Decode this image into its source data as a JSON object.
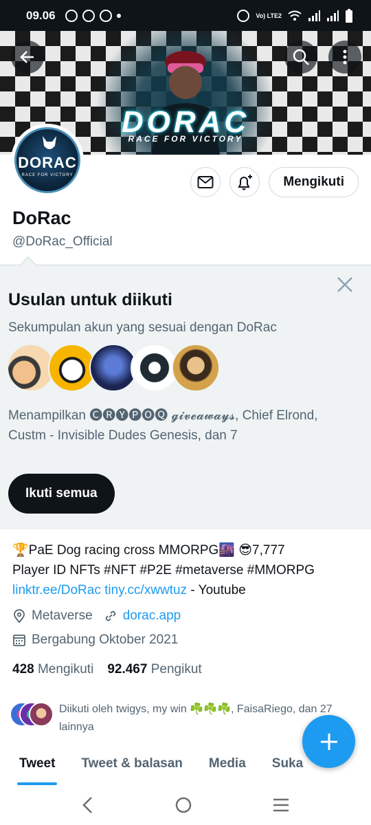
{
  "status_bar": {
    "time": "09.06",
    "icons_left": [
      "whatsapp-icon",
      "messenger-icon",
      "facebook-icon",
      "dot-icon"
    ],
    "icons_right": [
      "alarm-icon",
      "volte-icon",
      "wifi-icon",
      "signal-icon",
      "signal-icon",
      "battery-icon"
    ],
    "volte_text": "Vo) LTE2"
  },
  "banner": {
    "title": "DORAC",
    "subtitle": "RACE FOR VICTORY",
    "accent_color": "#22d3ee"
  },
  "profile": {
    "avatar_text": "DORAC",
    "avatar_sub": "RACE FOR VICTORY",
    "name": "DoRac",
    "handle": "@DoRac_Official",
    "follow_button": "Mengikuti"
  },
  "suggestions": {
    "title": "Usulan untuk diikuti",
    "description": "Sekumpulan akun yang sesuai dengan DoRac",
    "names": "Menampilkan 🅒🅡🅨🅟🅞🅠 𝓰𝓲𝓿𝓮𝓪𝔀𝓪𝔂𝓼, Chief Elrond, Custm - Invisible Dudes Genesis, dan 7",
    "follow_all_button": "Ikuti semua"
  },
  "bio": {
    "line1": "🏆PaE Dog racing cross MMORPG🌆 😎7,777",
    "line2": "Player ID NFTs #NFT #P2E #metaverse #MMORPG",
    "link1": "linktr.ee/DoRac",
    "link2": "tiny.cc/xwwtuz",
    "line3_suffix": " - Youtube"
  },
  "meta": {
    "location": "Metaverse",
    "website": "dorac.app",
    "joined": "Bergabung Oktober 2021"
  },
  "counts": {
    "following_value": "428",
    "following_label": "Mengikuti",
    "followers_value": "92.467",
    "followers_label": "Pengikut"
  },
  "followed_by": {
    "text": "Diikuti oleh twigys, my win ☘️☘️☘️, FaisaRiego, dan 27 lainnya"
  },
  "tabs": [
    {
      "label": "Tweet",
      "active": true
    },
    {
      "label": "Tweet & balasan",
      "active": false
    },
    {
      "label": "Media",
      "active": false
    },
    {
      "label": "Suka",
      "active": false
    }
  ],
  "colors": {
    "accent": "#1d9bf0",
    "text_primary": "#0f1419",
    "text_secondary": "#536471",
    "suggest_bg": "#eff3f4"
  }
}
